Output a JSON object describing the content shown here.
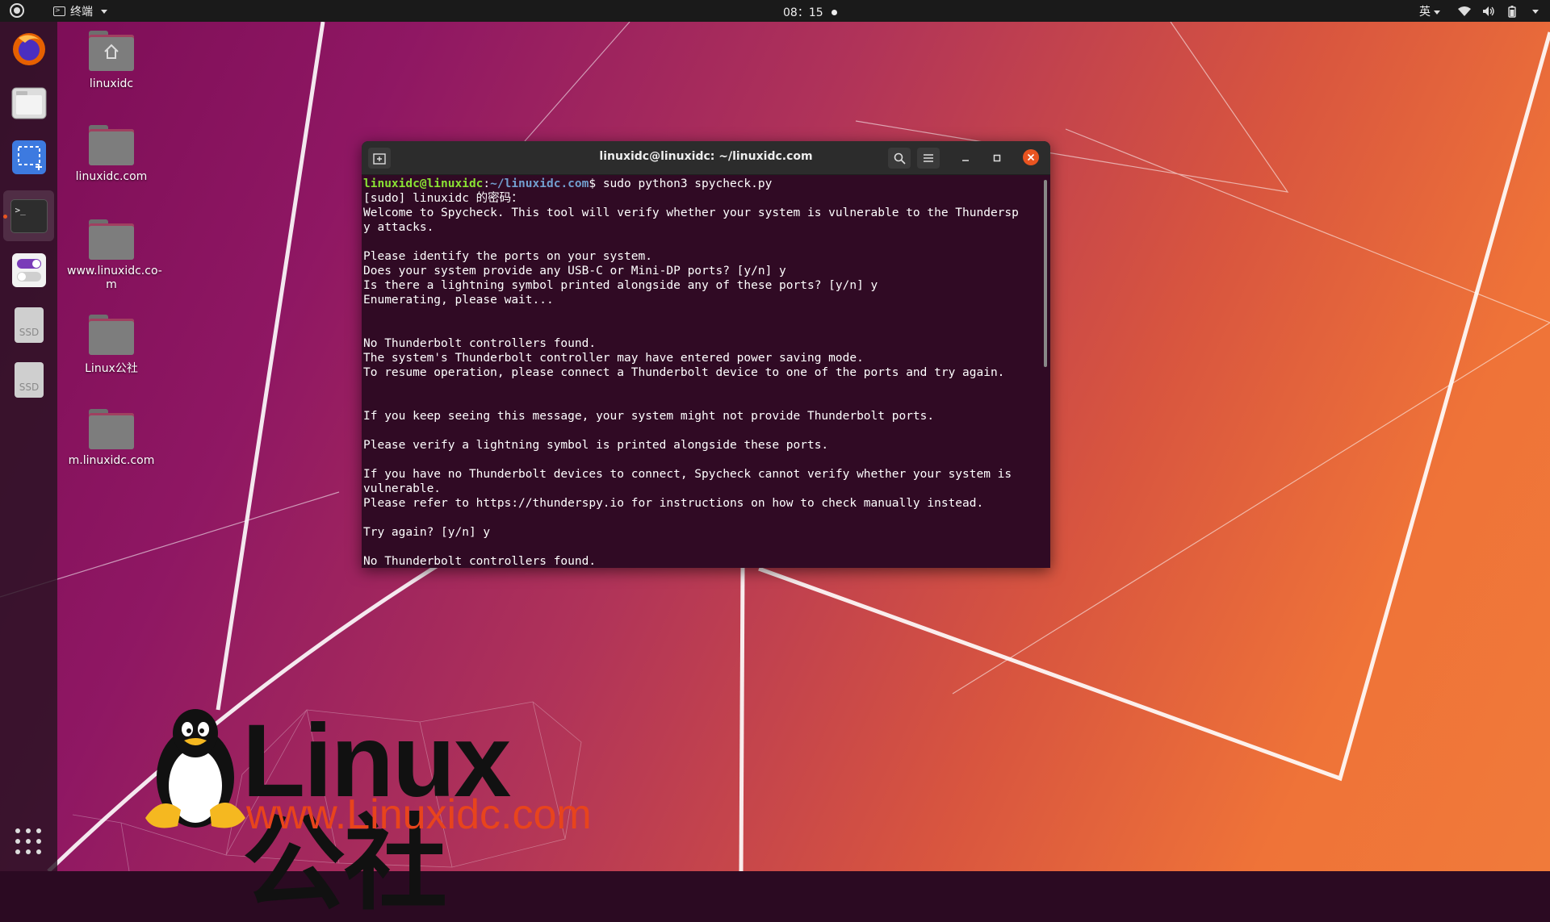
{
  "topbar": {
    "app_name": "终端",
    "clock": "08：15",
    "input_method": "英"
  },
  "dock": {
    "items": [
      "firefox",
      "files",
      "screenshot",
      "terminal",
      "settings",
      "ssd-drive-1",
      "ssd-drive-2"
    ],
    "ssd_label": "SSD",
    "terminal_glyph": ">_"
  },
  "desktop": {
    "icons": [
      {
        "label": "linuxidc"
      },
      {
        "label": "linuxidc.com"
      },
      {
        "label": "www.linuxidc.co-\nm"
      },
      {
        "label": "Linux公社"
      },
      {
        "label": "m.linuxidc.com"
      }
    ]
  },
  "terminal": {
    "title": "linuxidc@linuxidc: ~/linuxidc.com",
    "prompt_user": "linuxidc@linuxidc",
    "prompt_sep": ":",
    "prompt_path": "~/linuxidc.com",
    "prompt_cmd": "$ sudo python3 spycheck.py",
    "lines": [
      "[sudo] linuxidc 的密码：",
      "Welcome to Spycheck. This tool will verify whether your system is vulnerable to the Thundersp",
      "y attacks.",
      "",
      "Please identify the ports on your system.",
      "Does your system provide any USB-C or Mini-DP ports? [y/n] y",
      "Is there a lightning symbol printed alongside any of these ports? [y/n] y",
      "Enumerating, please wait...",
      "",
      "",
      "No Thunderbolt controllers found.",
      "The system's Thunderbolt controller may have entered power saving mode.",
      "To resume operation, please connect a Thunderbolt device to one of the ports and try again.",
      "",
      "",
      "If you keep seeing this message, your system might not provide Thunderbolt ports.",
      "",
      "Please verify a lightning symbol is printed alongside these ports.",
      "",
      "If you have no Thunderbolt devices to connect, Spycheck cannot verify whether your system is",
      "vulnerable.",
      "Please refer to https://thunderspy.io for instructions on how to check manually instead.",
      "",
      "Try again? [y/n] y",
      "",
      "No Thunderbolt controllers found."
    ]
  },
  "watermark": {
    "title": "Linux公社",
    "url": "www.Linuxidc.com"
  },
  "colors": {
    "terminal_bg": "#300a24",
    "prompt_user": "#8ae234",
    "prompt_path": "#729fcf",
    "close_button": "#e95420",
    "watermark_url": "#e8441c"
  }
}
